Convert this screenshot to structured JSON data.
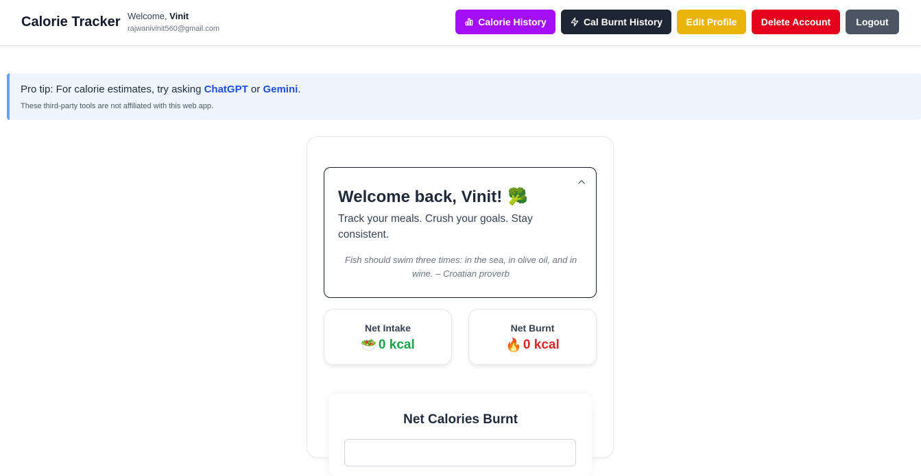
{
  "header": {
    "brand": "Calorie Tracker",
    "welcome_prefix": "Welcome, ",
    "user_name": "Vinit",
    "email": "rajwanivinit560@gmail.com",
    "buttons": {
      "calorie_history": "Calorie History",
      "cal_burnt_history": "Cal Burnt History",
      "edit_profile": "Edit Profile",
      "delete_account": "Delete Account",
      "logout": "Logout"
    },
    "colors": {
      "calorie_history": "#a30ef5",
      "cal_burnt_history": "#1e2535",
      "edit_profile": "#eab308",
      "delete_account": "#e4001b",
      "logout": "#4b5563"
    }
  },
  "tip": {
    "prefix": "Pro tip: For calorie estimates, try asking ",
    "link1": "ChatGPT",
    "middle": " or ",
    "link2": "Gemini",
    "suffix": ".",
    "note": "These third-party tools are not affiliated with this web app."
  },
  "hero": {
    "title": "Welcome back, Vinit!",
    "emoji": "🥦",
    "subtitle": "Track your meals. Crush your goals. Stay consistent.",
    "quote": "Fish should swim three times: in the sea, in olive oil, and in wine. – Croatian proverb"
  },
  "stats": {
    "intake": {
      "label": "Net Intake",
      "emoji": "🥗",
      "value": "0 kcal"
    },
    "burnt": {
      "label": "Net Burnt",
      "emoji": "🔥",
      "value": "0 kcal"
    }
  },
  "panel": {
    "title": "Net Calories Burnt"
  }
}
